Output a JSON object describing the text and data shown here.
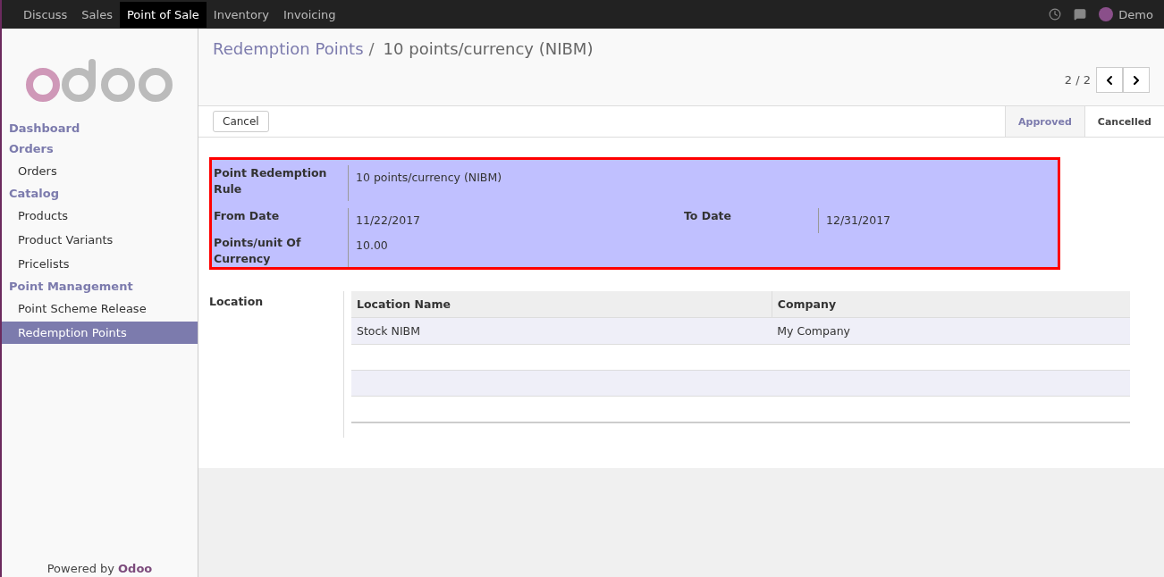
{
  "topbar": {
    "apps": [
      {
        "label": "Discuss",
        "selected": false
      },
      {
        "label": "Sales",
        "selected": false
      },
      {
        "label": "Point of Sale",
        "selected": true
      },
      {
        "label": "Inventory",
        "selected": false
      },
      {
        "label": "Invoicing",
        "selected": false
      }
    ],
    "user": "Demo"
  },
  "sidebar": {
    "sections": [
      {
        "title": "Dashboard"
      },
      {
        "title": "Orders",
        "items": [
          {
            "label": "Orders",
            "selected": false
          }
        ]
      },
      {
        "title": "Catalog",
        "items": [
          {
            "label": "Products",
            "selected": false
          },
          {
            "label": "Product Variants",
            "selected": false
          },
          {
            "label": "Pricelists",
            "selected": false
          }
        ]
      },
      {
        "title": "Point Management",
        "items": [
          {
            "label": "Point Scheme Release",
            "selected": false
          },
          {
            "label": "Redemption Points",
            "selected": true
          }
        ]
      }
    ],
    "powered_by": "Powered by",
    "powered_link": "Odoo"
  },
  "breadcrumb": {
    "parent": "Redemption Points",
    "separator": "/",
    "current": "10 points/currency (NIBM)"
  },
  "pager": "2 / 2",
  "cancel_button": "Cancel",
  "statuses": [
    {
      "label": "Approved",
      "selected": false
    },
    {
      "label": "Cancelled",
      "selected": true
    }
  ],
  "form": {
    "rule_label": "Point Redemption Rule",
    "rule_value": "10 points/currency (NIBM)",
    "from_label": "From Date",
    "from_value": "11/22/2017",
    "to_label": "To Date",
    "to_value": "12/31/2017",
    "points_label": "Points/unit Of Currency",
    "points_value": "10.00"
  },
  "location": {
    "label": "Location",
    "columns": [
      "Location Name",
      "Company"
    ],
    "rows": [
      [
        "Stock NIBM",
        "My Company"
      ]
    ]
  }
}
